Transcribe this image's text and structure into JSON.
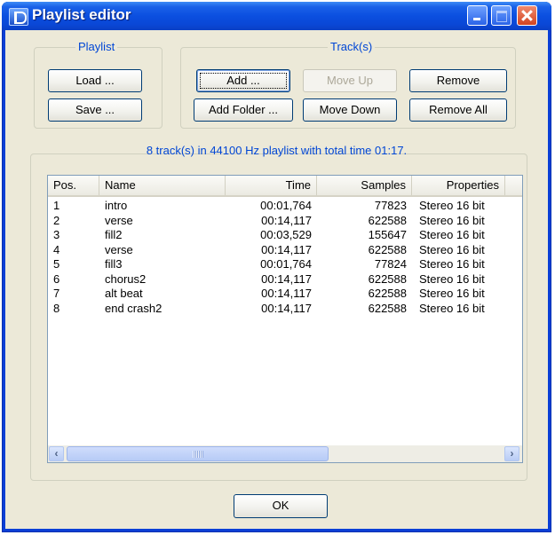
{
  "window": {
    "title": "Playlist editor"
  },
  "playlist_group": {
    "label": "Playlist",
    "load": "Load ...",
    "save": "Save ..."
  },
  "tracks_group": {
    "label": "Track(s)",
    "add": "Add ...",
    "add_folder": "Add Folder ...",
    "move_up": "Move Up",
    "move_down": "Move Down",
    "remove": "Remove",
    "remove_all": "Remove All"
  },
  "status": "8 track(s) in 44100 Hz playlist with total time 01:17.",
  "columns": [
    "Pos.",
    "Name",
    "Time",
    "Samples",
    "Properties"
  ],
  "tracks": [
    {
      "pos": "1",
      "name": "intro",
      "time": "00:01,764",
      "samples": "77823",
      "props": "Stereo 16 bit"
    },
    {
      "pos": "2",
      "name": "verse",
      "time": "00:14,117",
      "samples": "622588",
      "props": "Stereo 16 bit"
    },
    {
      "pos": "3",
      "name": "fill2",
      "time": "00:03,529",
      "samples": "155647",
      "props": "Stereo 16 bit"
    },
    {
      "pos": "4",
      "name": "verse",
      "time": "00:14,117",
      "samples": "622588",
      "props": "Stereo 16 bit"
    },
    {
      "pos": "5",
      "name": "fill3",
      "time": "00:01,764",
      "samples": "77824",
      "props": "Stereo 16 bit"
    },
    {
      "pos": "6",
      "name": "chorus2",
      "time": "00:14,117",
      "samples": "622588",
      "props": "Stereo 16 bit"
    },
    {
      "pos": "7",
      "name": "alt beat",
      "time": "00:14,117",
      "samples": "622588",
      "props": "Stereo 16 bit"
    },
    {
      "pos": "8",
      "name": "end crash2",
      "time": "00:14,117",
      "samples": "622588",
      "props": "Stereo 16 bit"
    }
  ],
  "ok": "OK",
  "icons": {
    "app": "app-icon",
    "scroll_left": "scroll-left-icon",
    "scroll_right": "scroll-right-icon"
  },
  "colors": {
    "titlebar": "#0a47d6",
    "group_label": "#0046d5",
    "client": "#ece9d8"
  }
}
